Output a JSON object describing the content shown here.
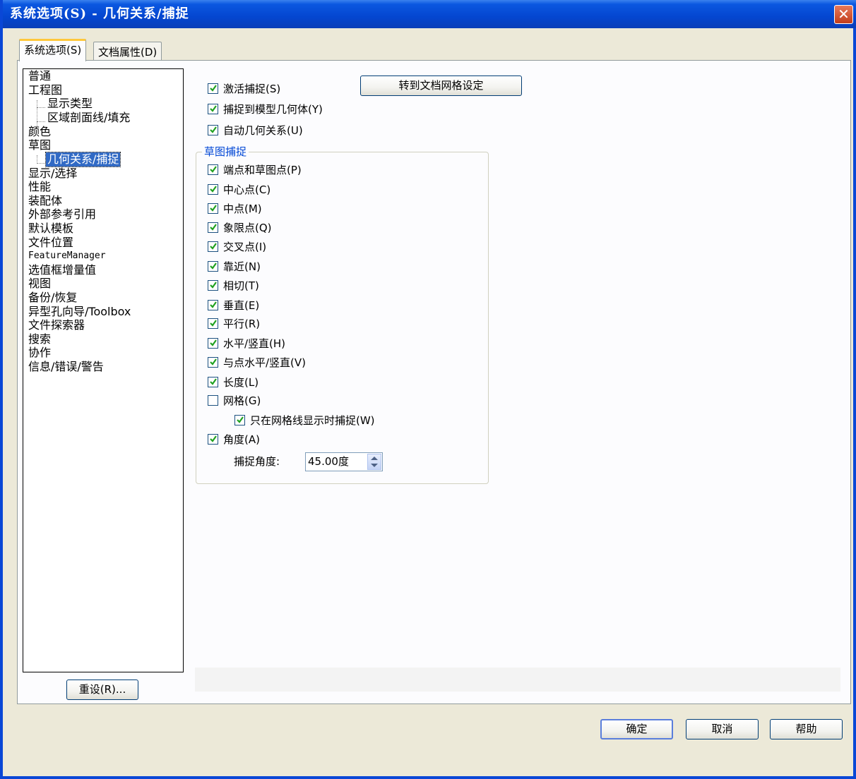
{
  "window": {
    "title": "系统选项(S) - 几何关系/捕捉",
    "close_glyph": "✕"
  },
  "tabs": [
    {
      "label": "系统选项(S)",
      "active": true
    },
    {
      "label": "文档属性(D)",
      "active": false
    }
  ],
  "tree": {
    "items": [
      {
        "label": "普通"
      },
      {
        "label": "工程图"
      },
      {
        "label": "显示类型"
      },
      {
        "label": "区域剖面线/填充"
      },
      {
        "label": "颜色"
      },
      {
        "label": "草图"
      },
      {
        "label": "几何关系/捕捉",
        "selected": true
      },
      {
        "label": "显示/选择"
      },
      {
        "label": "性能"
      },
      {
        "label": "装配体"
      },
      {
        "label": "外部参考引用"
      },
      {
        "label": "默认模板"
      },
      {
        "label": "文件位置"
      },
      {
        "label": "FeatureManager"
      },
      {
        "label": "选值框增量值"
      },
      {
        "label": "视图"
      },
      {
        "label": "备份/恢复"
      },
      {
        "label": "异型孔向导/Toolbox"
      },
      {
        "label": "文件探索器"
      },
      {
        "label": "搜索"
      },
      {
        "label": "协作"
      },
      {
        "label": "信息/错误/警告"
      }
    ]
  },
  "reset_button": "重设(R)...",
  "doc_grid_button": "转到文档网格设定",
  "top_options": [
    {
      "label": "激活捕捉(S)",
      "checked": true
    },
    {
      "label": "捕捉到模型几何体(Y)",
      "checked": true
    },
    {
      "label": "自动几何关系(U)",
      "checked": true
    }
  ],
  "sketch_snaps": {
    "title": "草图捕捉",
    "options": [
      {
        "label": "端点和草图点(P)",
        "checked": true
      },
      {
        "label": "中心点(C)",
        "checked": true
      },
      {
        "label": "中点(M)",
        "checked": true
      },
      {
        "label": "象限点(Q)",
        "checked": true
      },
      {
        "label": "交叉点(I)",
        "checked": true
      },
      {
        "label": "靠近(N)",
        "checked": true
      },
      {
        "label": "相切(T)",
        "checked": true
      },
      {
        "label": "垂直(E)",
        "checked": true
      },
      {
        "label": "平行(R)",
        "checked": true
      },
      {
        "label": "水平/竖直(H)",
        "checked": true
      },
      {
        "label": "与点水平/竖直(V)",
        "checked": true
      },
      {
        "label": "长度(L)",
        "checked": true
      },
      {
        "label": "网格(G)",
        "checked": false
      },
      {
        "label": "只在网格线显示时捕捉(W)",
        "checked": true
      },
      {
        "label": "角度(A)",
        "checked": true
      }
    ],
    "angle_label": "捕捉角度:",
    "angle_value": "45.00度"
  },
  "footer": {
    "ok": "确定",
    "cancel": "取消",
    "help": "帮助"
  },
  "colors": {
    "title_bar": "#0446d0",
    "selected_item": "#316ac5",
    "group_title": "#0046d5",
    "dialog_bg": "#ece9d8"
  }
}
